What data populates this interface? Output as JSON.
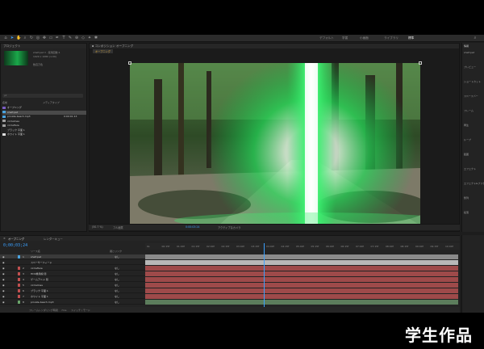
{
  "workspaces": [
    {
      "label": "デフォルト",
      "active": false
    },
    {
      "label": "学習",
      "active": false
    },
    {
      "label": "小画面",
      "active": false
    },
    {
      "label": "ライブラリ",
      "active": false
    },
    {
      "label": "標準",
      "active": true
    }
  ],
  "project": {
    "tab_label": "プロジェクト",
    "thumb_info": [
      "shelf.psd ▾ , 使用回数:1",
      "1920 x 1080 (1.00)",
      "",
      "数百万色"
    ],
    "search_placeholder": "ρ▾",
    "col_name": "名前",
    "col_type": "メディアタイプ",
    "items": [
      {
        "name": "オープニング",
        "color": "#7a5cc4",
        "date": "",
        "sel": false
      },
      {
        "name": "shelf.psd",
        "color": "#4aa3df",
        "date": "",
        "sel": true
      },
      {
        "name": "private-beach.mp3",
        "color": "#4aa3df",
        "date": "0:00:01:13",
        "sel": false
      },
      {
        "name": "circlelines",
        "color": "#9e9e9e",
        "date": "",
        "sel": false
      },
      {
        "name": "circleflare",
        "color": "#9e9e9e",
        "date": "",
        "sel": false
      },
      {
        "name": "ブラック 平面 1",
        "color": "#222222",
        "date": "",
        "sel": false
      },
      {
        "name": "ホワイト 平面 1",
        "color": "#dddddd",
        "date": "",
        "sel": false
      }
    ]
  },
  "composition": {
    "tab_label": "コンポジション オープニング",
    "sub_tab": "オープニング"
  },
  "viewer_footer": {
    "zoom": "(50.7 %)",
    "resolution": "フル画質",
    "timecode": "0:00:03:24",
    "camera": "アクティブなカメラ"
  },
  "right_panel": {
    "header": "情報",
    "lines": [
      "shelf.psd",
      "プレビュー",
      "ショートカット",
      "スペースバー",
      "フレーム",
      "再生",
      "ループ",
      "範囲",
      "エフェクト",
      "エフェクト&プリセット",
      "整列",
      "段落"
    ]
  },
  "timeline": {
    "tab_comp": "オープニング",
    "tab_queue": "レンダーキュー",
    "timecode": "0;00;03;24",
    "col_source": "ソース名",
    "col_parent": "親とリンク",
    "ticks": [
      "0s",
      "00:15f",
      "01:00f",
      "01:15f",
      "02:00f",
      "02:15f",
      "03:00f",
      "03:15f",
      "04:00f",
      "04:15f",
      "05:00f",
      "05:15f",
      "06:00f",
      "06:15f",
      "07:00f",
      "07:15f",
      "08:00f",
      "08:15f",
      "09:00f",
      "09:15f",
      "10:00f"
    ],
    "layers": [
      {
        "num": "1",
        "name": "shelf.psd",
        "color": "#4aa3df",
        "bar": "#8a8a8a",
        "sel": true,
        "parent": "なし"
      },
      {
        "num": "",
        "name": "スペーサーフィード",
        "color": "",
        "bar": "#b8b8b8",
        "sel": false,
        "parent": ""
      },
      {
        "num": "2",
        "name": "circleflare",
        "color": "#c05050",
        "bar": "#9e4a4a",
        "sel": false,
        "parent": "なし"
      },
      {
        "num": "3",
        "name": "HD9重用線 閉",
        "color": "#c05050",
        "bar": "#9e4a4a",
        "sel": false,
        "parent": "なし"
      },
      {
        "num": "4",
        "name": "ゲームアニメ 閉",
        "color": "#c05050",
        "bar": "#9e4a4a",
        "sel": false,
        "parent": "なし"
      },
      {
        "num": "5",
        "name": "circlelines",
        "color": "#c05050",
        "bar": "#9e4a4a",
        "sel": false,
        "parent": "なし"
      },
      {
        "num": "6",
        "name": "ブラック 平面 1",
        "color": "#c05050",
        "bar": "#9e4a4a",
        "sel": false,
        "parent": "なし"
      },
      {
        "num": "7",
        "name": "ホワイト 平面 1",
        "color": "#c05050",
        "bar": "#9e4a4a",
        "sel": false,
        "parent": "なし"
      },
      {
        "num": "8",
        "name": "private-beach.mp3",
        "color": "#6aa36a",
        "bar": "#5c7d5c",
        "sel": false,
        "parent": "なし"
      }
    ],
    "footer_left": "フレームレンダリング時間",
    "footer_time": "7ms",
    "footer_mode": "スイッチ / モード"
  },
  "watermark": "学生作品",
  "colors": {
    "accent": "#3aa0ff",
    "panel": "#232323",
    "background": "#1d1d1d"
  }
}
